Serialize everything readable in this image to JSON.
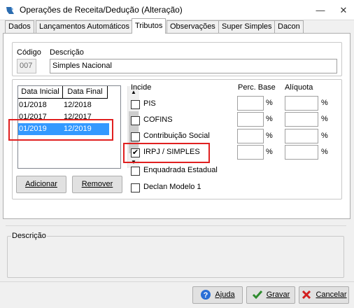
{
  "window": {
    "title": "Operações de Receita/Dedução (Alteração)",
    "minimize_icon": "minimize-icon",
    "close_icon": "close-icon"
  },
  "tabs": [
    {
      "label": "Dados",
      "active": false
    },
    {
      "label": "Lançamentos Automáticos",
      "active": false
    },
    {
      "label": "Tributos",
      "active": true
    },
    {
      "label": "Observações",
      "active": false
    },
    {
      "label": "Super Simples",
      "active": false
    },
    {
      "label": "Dacon",
      "active": false
    }
  ],
  "header": {
    "codigo_label": "Código",
    "codigo_value": "007",
    "descricao_label": "Descrição",
    "descricao_value": "Simples Nacional"
  },
  "periods": {
    "columns": [
      "Data Inicial",
      "Data Final"
    ],
    "rows": [
      {
        "inicial": "01/2018",
        "final": "12/2018",
        "selected": false
      },
      {
        "inicial": "01/2017",
        "final": "12/2017",
        "selected": false
      },
      {
        "inicial": "01/2019",
        "final": "12/2019",
        "selected": true
      }
    ],
    "add_button": "Adicionar",
    "remove_button": "Remover"
  },
  "tributos": {
    "incide_label": "Incide",
    "perc_base_label": "Perc. Base",
    "aliquota_label": "Alíquota",
    "percent_sign": "%",
    "items": [
      {
        "label": "PIS",
        "checked": false
      },
      {
        "label": "COFINS",
        "checked": false
      },
      {
        "label": "Contribuição Social",
        "checked": false
      },
      {
        "label": "IRPJ / SIMPLES",
        "checked": true
      },
      {
        "label": "Enquadrada Estadual",
        "checked": false
      },
      {
        "label": "Declan Modelo 1",
        "checked": false
      }
    ],
    "check_mark": "✔"
  },
  "descricao_box": {
    "label": "Descrição"
  },
  "footer": {
    "ajuda": "Ajuda",
    "gravar": "Gravar",
    "cancelar": "Cancelar"
  },
  "colors": {
    "selection": "#3399ff",
    "highlight_red": "#e02020",
    "help_icon_blue": "#2a6fd6",
    "save_icon_green": "#2e8b2e",
    "cancel_icon_red": "#d21f1f"
  }
}
